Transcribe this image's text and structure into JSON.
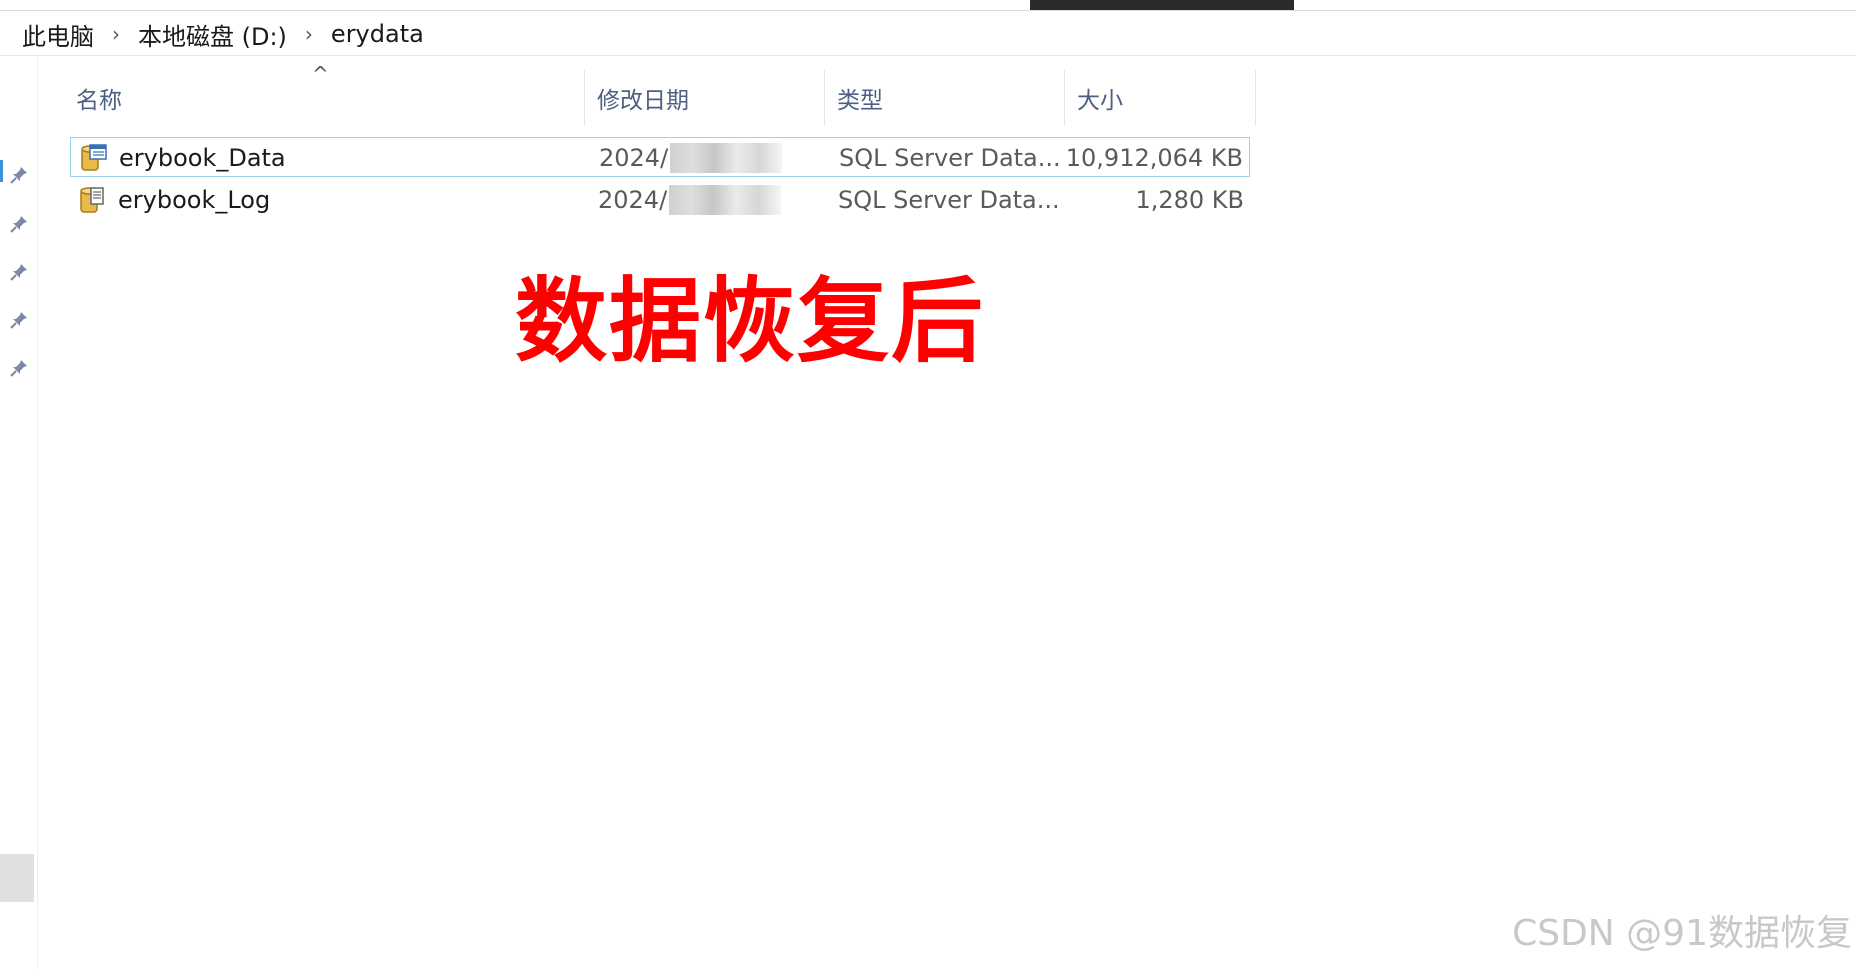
{
  "breadcrumb": {
    "items": [
      "此电脑",
      "本地磁盘 (D:)",
      "erydata"
    ],
    "separator": "›"
  },
  "columns": {
    "name": "名称",
    "modified": "修改日期",
    "type": "类型",
    "size": "大小",
    "sort_indicator": "^"
  },
  "files": [
    {
      "name": "erybook_Data",
      "modified": "2024/",
      "type": "SQL Server Data...",
      "size": "10,912,064 KB",
      "icon": "sql-data-file-icon",
      "selected": true
    },
    {
      "name": "erybook_Log",
      "modified": "2024/",
      "type": "SQL Server Data...",
      "size": "1,280 KB",
      "icon": "sql-log-file-icon",
      "selected": false
    }
  ],
  "overlay": {
    "text": "数据恢复后",
    "color": "#ff0000"
  },
  "watermark": {
    "text": "CSDN @91数据恢复"
  },
  "colors": {
    "header_text": "#4d6082",
    "selection_border": "#99d1f1",
    "nav_accent": "#3c8fdc"
  },
  "icons": {
    "pin": "pin-icon",
    "breadcrumb_separator": "chevron-right-icon",
    "sort": "sort-up-icon"
  }
}
